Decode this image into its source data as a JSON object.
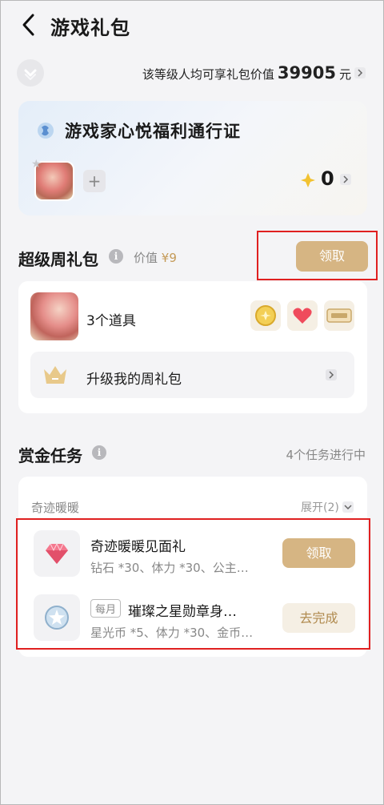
{
  "header": {
    "title": "游戏礼包",
    "back_icon": "chevron-left-icon"
  },
  "level": {
    "prefix": "该等级人均可享礼包价值",
    "value": "39905",
    "unit": "元"
  },
  "pass_card": {
    "title": "游戏家心悦福利通行证",
    "add_label": "+",
    "coin_count": "0"
  },
  "weekly_pack": {
    "title": "超级周礼包",
    "value_label": "价值",
    "value_price": "¥9",
    "claim_label": "领取",
    "items_label": "3个道具",
    "upgrade_label": "升级我的周礼包"
  },
  "bounty": {
    "title": "赏金任务",
    "status": "4个任务进行中",
    "group_label": "奇迹暖暖",
    "expand_label": "展开(2)",
    "tasks": [
      {
        "name": "奇迹暖暖见面礼",
        "rewards": "钻石 *30、体力 *30、公主…",
        "action": "领取"
      },
      {
        "tag": "每月",
        "name": "璀璨之星勋章身…",
        "rewards": "星光币 *5、体力 *30、金币…",
        "action": "去完成"
      }
    ]
  },
  "colors": {
    "accent_gold": "#d6b583",
    "highlight_red": "#e02020",
    "background": "#f4f4f6"
  }
}
